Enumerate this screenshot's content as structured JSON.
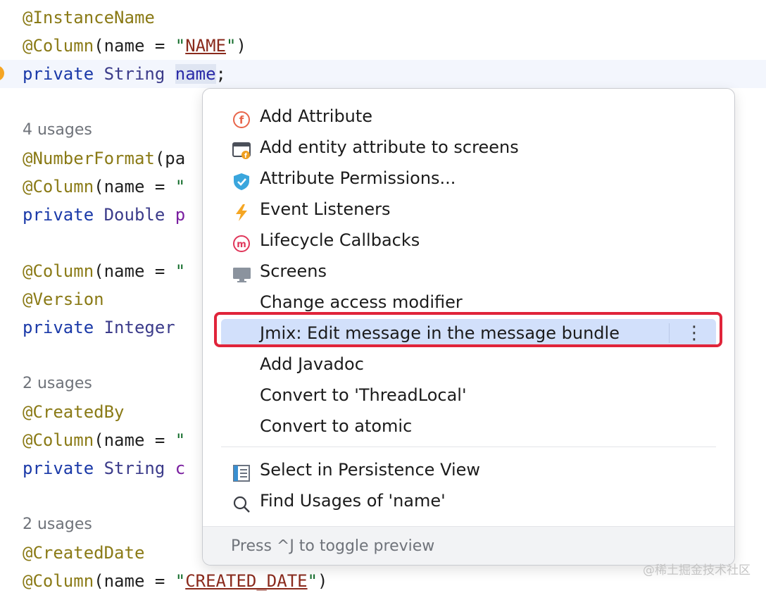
{
  "editor": {
    "lines": [
      {
        "kind": "code",
        "parts": [
          {
            "t": "@InstanceName",
            "c": "ann"
          }
        ]
      },
      {
        "kind": "code",
        "parts": [
          {
            "t": "@Column",
            "c": "ann"
          },
          {
            "t": "(name = ",
            "c": "plain"
          },
          {
            "t": "\"",
            "c": "str"
          },
          {
            "t": "NAME",
            "c": "str-u"
          },
          {
            "t": "\"",
            "c": "str"
          },
          {
            "t": ")",
            "c": "plain"
          }
        ]
      },
      {
        "kind": "code",
        "current": true,
        "parts": [
          {
            "t": "private ",
            "c": "kw"
          },
          {
            "t": "String ",
            "c": "type"
          },
          {
            "t": "name",
            "c": "ident-hl"
          },
          {
            "t": ";",
            "c": "plain"
          }
        ]
      },
      {
        "kind": "blank"
      },
      {
        "kind": "usages",
        "text": "4 usages"
      },
      {
        "kind": "code",
        "parts": [
          {
            "t": "@NumberFormat",
            "c": "ann"
          },
          {
            "t": "(pa",
            "c": "plain"
          }
        ]
      },
      {
        "kind": "code",
        "parts": [
          {
            "t": "@Column",
            "c": "ann"
          },
          {
            "t": "(name = ",
            "c": "plain"
          },
          {
            "t": "\"",
            "c": "str"
          }
        ]
      },
      {
        "kind": "code",
        "parts": [
          {
            "t": "private ",
            "c": "kw"
          },
          {
            "t": "Double ",
            "c": "type"
          },
          {
            "t": "p",
            "c": "ident-p"
          }
        ]
      },
      {
        "kind": "blank"
      },
      {
        "kind": "code",
        "parts": [
          {
            "t": "@Column",
            "c": "ann"
          },
          {
            "t": "(name = ",
            "c": "plain"
          },
          {
            "t": "\"",
            "c": "str"
          }
        ]
      },
      {
        "kind": "code",
        "parts": [
          {
            "t": "@Version",
            "c": "ann"
          }
        ]
      },
      {
        "kind": "code",
        "parts": [
          {
            "t": "private ",
            "c": "kw"
          },
          {
            "t": "Integer",
            "c": "type"
          }
        ]
      },
      {
        "kind": "blank"
      },
      {
        "kind": "usages",
        "text": "2 usages"
      },
      {
        "kind": "code",
        "parts": [
          {
            "t": "@CreatedBy",
            "c": "ann"
          }
        ]
      },
      {
        "kind": "code",
        "parts": [
          {
            "t": "@Column",
            "c": "ann"
          },
          {
            "t": "(name = ",
            "c": "plain"
          },
          {
            "t": "\"",
            "c": "str"
          }
        ]
      },
      {
        "kind": "code",
        "parts": [
          {
            "t": "private ",
            "c": "kw"
          },
          {
            "t": "String ",
            "c": "type"
          },
          {
            "t": "c",
            "c": "ident-p"
          }
        ]
      },
      {
        "kind": "blank"
      },
      {
        "kind": "usages",
        "text": "2 usages"
      },
      {
        "kind": "code",
        "parts": [
          {
            "t": "@CreatedDate",
            "c": "ann"
          }
        ]
      },
      {
        "kind": "code",
        "parts": [
          {
            "t": "@Column",
            "c": "ann"
          },
          {
            "t": "(name = ",
            "c": "plain"
          },
          {
            "t": "\"",
            "c": "str"
          },
          {
            "t": "CREATED_DATE",
            "c": "str-u"
          },
          {
            "t": "\"",
            "c": "str"
          },
          {
            "t": ")",
            "c": "plain"
          }
        ]
      }
    ]
  },
  "popup": {
    "items": [
      {
        "label": "Add Attribute",
        "icon": "field-f-icon"
      },
      {
        "label": "Add entity attribute to screens",
        "icon": "screen-field-icon"
      },
      {
        "label": "Attribute Permissions...",
        "icon": "shield-check-icon"
      },
      {
        "label": "Event Listeners",
        "icon": "lightning-icon"
      },
      {
        "label": "Lifecycle Callbacks",
        "icon": "method-m-icon"
      },
      {
        "label": "Screens",
        "icon": "monitor-icon"
      },
      {
        "label": "Change access modifier",
        "icon": ""
      },
      {
        "label": "Jmix: Edit message in the message bundle",
        "icon": "",
        "selected": true
      },
      {
        "label": "Add Javadoc",
        "icon": ""
      },
      {
        "label": "Convert to 'ThreadLocal'",
        "icon": ""
      },
      {
        "label": "Convert to atomic",
        "icon": ""
      }
    ],
    "items_after_divider": [
      {
        "label": "Select in Persistence View",
        "icon": "persistence-view-icon"
      },
      {
        "label": "Find Usages of 'name'",
        "icon": "search-icon"
      }
    ],
    "more_glyph": "⋮",
    "footer_hint": "Press ^J to toggle preview"
  },
  "watermark": "@稀土掘金技术社区",
  "colors": {
    "selection": "#d2e0fb",
    "highlight_frame": "#e0243a",
    "annotation": "#8a7a16",
    "keyword": "#1a39a8"
  }
}
